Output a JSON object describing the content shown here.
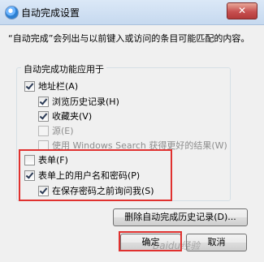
{
  "window": {
    "title": "自动完成设置",
    "close_label": "✕",
    "icon": "settings-globe-icon"
  },
  "description": "“自动完成”会列出与以前键入或访问的条目可能匹配的内容。",
  "group": {
    "legend": "自动完成功能应用于",
    "options": [
      {
        "label": "地址栏(A)",
        "checked": true,
        "enabled": true
      },
      {
        "label": "浏览历史记录(H)",
        "checked": true,
        "enabled": true
      },
      {
        "label": "收藏夹(V)",
        "checked": true,
        "enabled": true
      },
      {
        "label": "源(E)",
        "checked": false,
        "enabled": false
      },
      {
        "label": "使用 Windows Search 获得更好的结果(W)",
        "checked": false,
        "enabled": false
      },
      {
        "label": "表单(F)",
        "checked": false,
        "enabled": true
      },
      {
        "label": "表单上的用户名和密码(P)",
        "checked": true,
        "enabled": true
      },
      {
        "label": "在保存密码之前询问我(S)",
        "checked": true,
        "enabled": true
      }
    ]
  },
  "buttons": {
    "delete_history": "删除自动完成历史记录(D)...",
    "ok": "确定",
    "cancel": "取消"
  },
  "watermark": "Baidu经验",
  "colors": {
    "highlight_red": "#e0312f",
    "titlebar": "#c6d9ef"
  }
}
